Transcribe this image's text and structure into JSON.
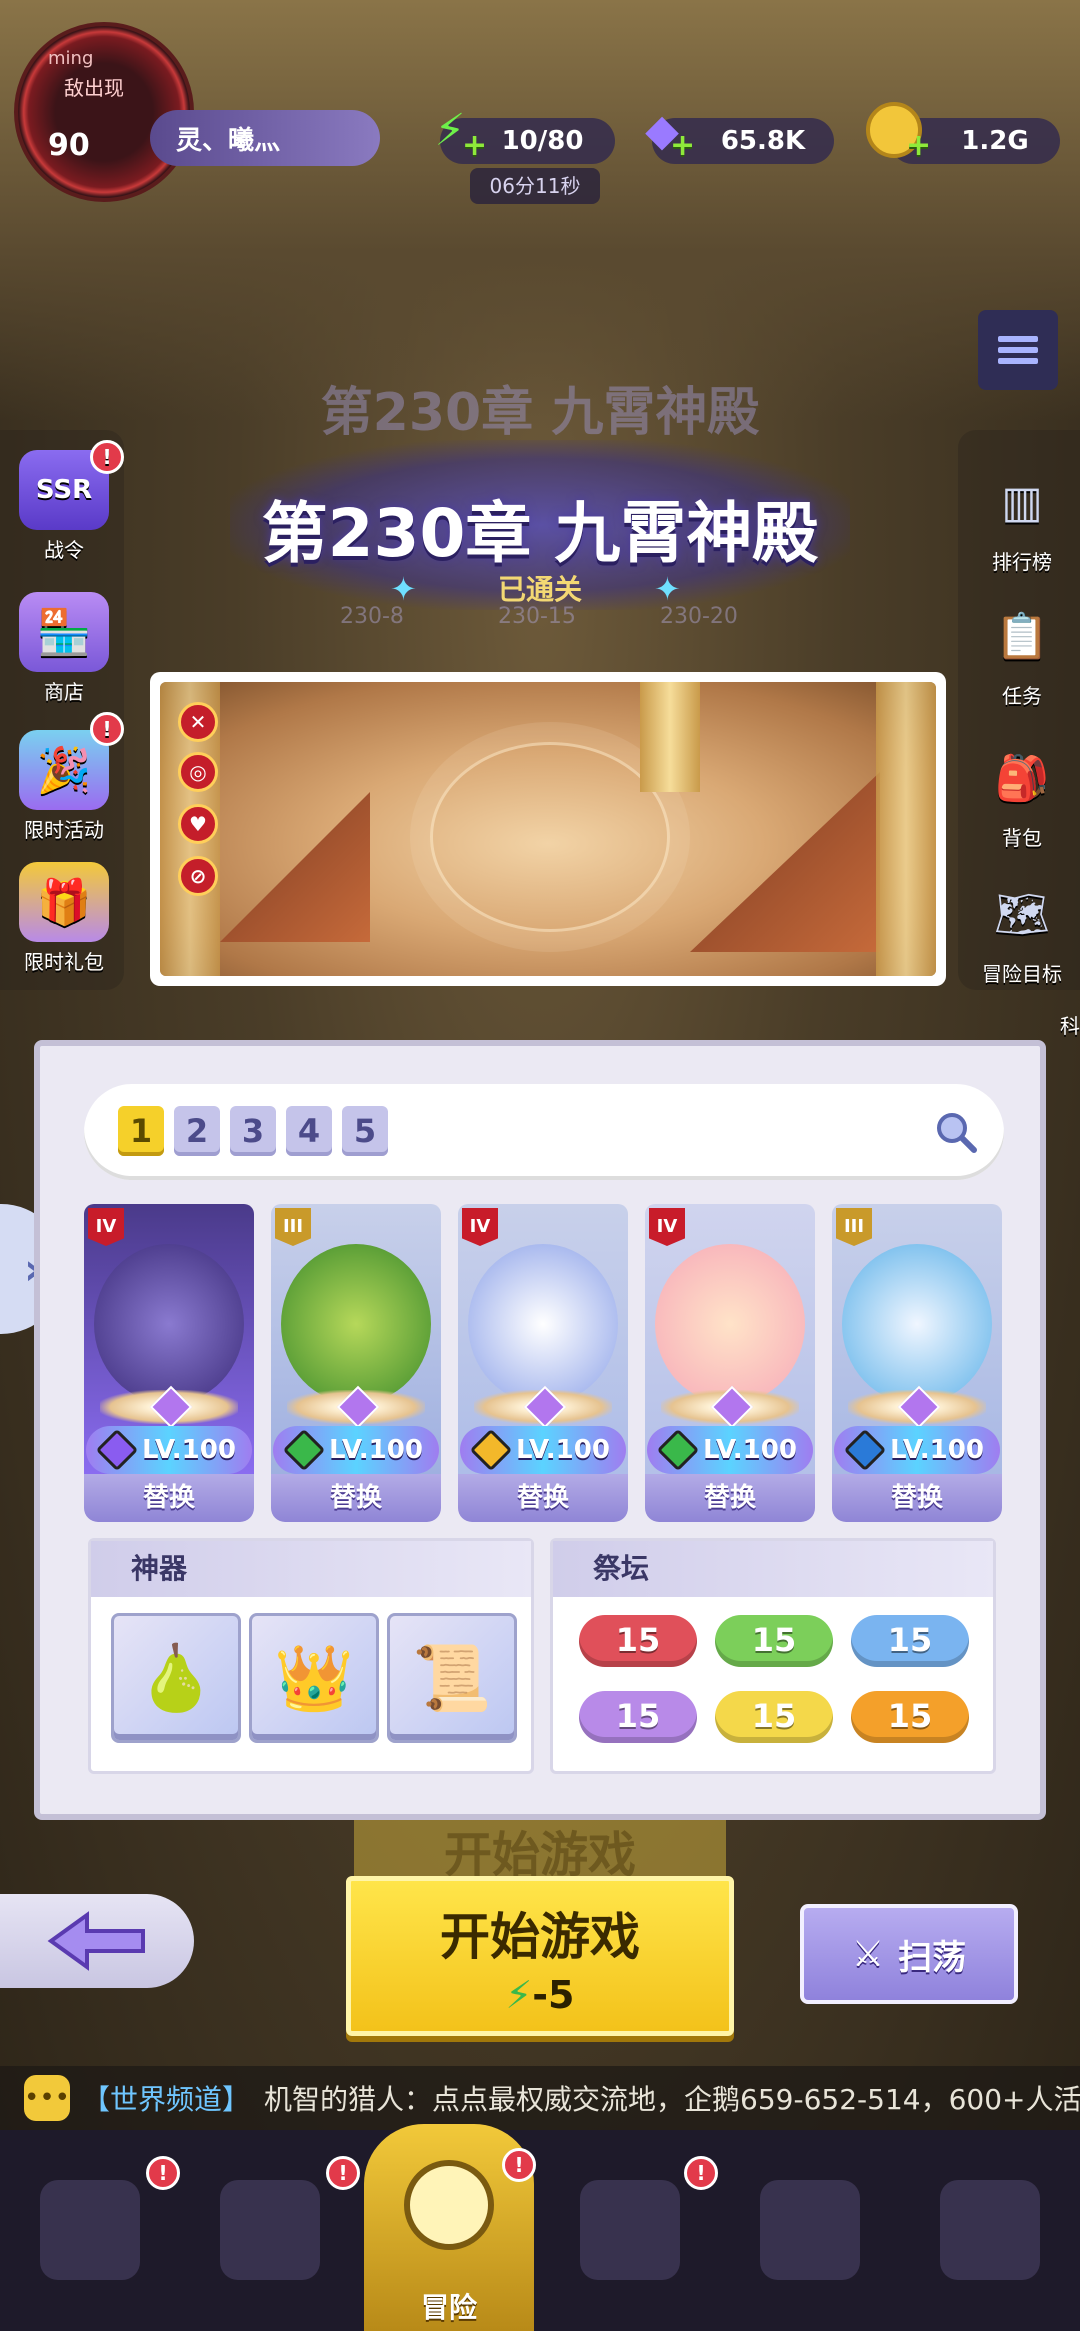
{
  "player": {
    "level": "90",
    "status_tag": "ming",
    "avatar_text": "敌出现",
    "name": "灵、曦灬"
  },
  "resources": {
    "energy": "10/80",
    "energy_timer": "06分11秒",
    "gems": "65.8K",
    "gold": "1.2G"
  },
  "left_menu": [
    {
      "label": "战令",
      "icon": "ssr-icon",
      "icon_text": "SSR",
      "badge": "!"
    },
    {
      "label": "商店",
      "icon": "shop-icon",
      "badge": ""
    },
    {
      "label": "限时活动",
      "icon": "event-icon",
      "badge": "!"
    },
    {
      "label": "限时礼包",
      "icon": "gift-icon",
      "badge": ""
    }
  ],
  "right_menu": [
    {
      "label": "排行榜",
      "icon": "ranking-icon"
    },
    {
      "label": "任务",
      "icon": "task-icon"
    },
    {
      "label": "背包",
      "icon": "backpack-icon"
    },
    {
      "label": "冒险目标",
      "icon": "adventure-goal-icon"
    },
    {
      "label": "科",
      "icon": "tech-icon"
    }
  ],
  "chapter": {
    "ghost_title": "第230章 九霄神殿",
    "title": "第230章 九霄神殿",
    "status": "已通关",
    "stages": [
      "230-8",
      "230-15",
      "230-20"
    ]
  },
  "team": {
    "tabs": [
      "1",
      "2",
      "3",
      "4",
      "5"
    ],
    "active_tab": "1",
    "heroes": [
      {
        "tier": "IV",
        "level": "LV.100",
        "action": "替换",
        "gem_color": "#8a5cf0",
        "art_color": "#5a3aa8"
      },
      {
        "tier": "III",
        "level": "LV.100",
        "action": "替换",
        "gem_color": "#3ab84a",
        "art_color": "#7aa83a"
      },
      {
        "tier": "IV",
        "level": "LV.100",
        "action": "替换",
        "gem_color": "#f3b82a",
        "art_color": "#9ab0f0"
      },
      {
        "tier": "IV",
        "level": "LV.100",
        "action": "替换",
        "gem_color": "#3ab84a",
        "art_color": "#f6b6b6"
      },
      {
        "tier": "III",
        "level": "LV.100",
        "action": "替换",
        "gem_color": "#2a7ad8",
        "art_color": "#6ec0f0"
      }
    ]
  },
  "artifacts": {
    "label": "神器",
    "items": [
      {
        "name": "purple-gourd-icon"
      },
      {
        "name": "golden-crown-icon"
      },
      {
        "name": "scroll-icon"
      }
    ]
  },
  "altar": {
    "label": "祭坛",
    "values": [
      {
        "value": "15",
        "color": "#e0505a"
      },
      {
        "value": "15",
        "color": "#7ccf5a"
      },
      {
        "value": "15",
        "color": "#7ab4f0"
      },
      {
        "value": "15",
        "color": "#b88ae8"
      },
      {
        "value": "15",
        "color": "#f4d84a"
      },
      {
        "value": "15",
        "color": "#f4a02a"
      }
    ]
  },
  "actions": {
    "ghost_start": "开始游戏",
    "start": "开始游戏",
    "cost": "-5",
    "sweep": "扫荡"
  },
  "chat": {
    "channel": "【世界频道】",
    "message": "机智的猎人：点点最权威交流地，企鹅659-652-514，600+人活"
  },
  "nav": {
    "active_label": "冒险",
    "tabs": [
      "cards-icon",
      "hero-icon",
      "adventure-icon",
      "castle-icon",
      "guild-icon",
      "shop-icon"
    ]
  }
}
